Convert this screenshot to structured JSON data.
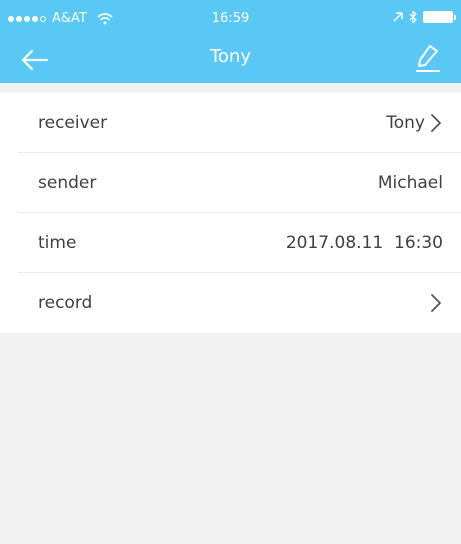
{
  "status_bar": {
    "carrier": "A&AT",
    "time": "16:59"
  },
  "nav": {
    "title": "Tony",
    "back_icon": "arrow-left-icon",
    "edit_icon": "pen-icon"
  },
  "details": {
    "rows": [
      {
        "label": "receiver",
        "value": "Tony"
      },
      {
        "label": "sender",
        "value": "Michael"
      },
      {
        "label": "time",
        "value": "2017.08.11  16:30"
      },
      {
        "label": "record",
        "value": ""
      }
    ]
  },
  "colors": {
    "header": "#5ac8f5",
    "background": "#f2f2f2",
    "row": "#ffffff"
  }
}
